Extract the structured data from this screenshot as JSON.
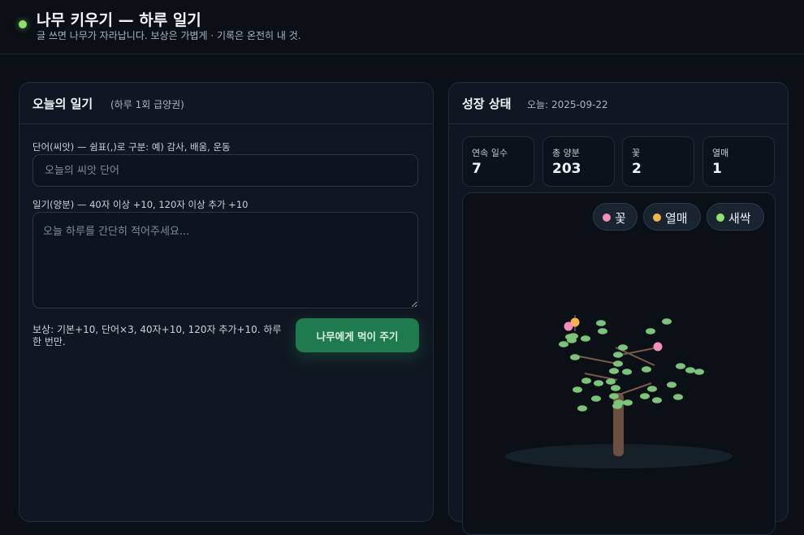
{
  "header": {
    "title": "나무 키우기 — 하루 일기",
    "subtitle": "글 쓰면 나무가 자라납니다. 보상은 가볍게 · 기록은 온전히 내 것.",
    "status_color": "#8fe36b"
  },
  "diary": {
    "title": "오늘의 일기",
    "note": "(하루 1회 급양권)",
    "seed_label": "단어(씨앗) — 쉼표(,)로 구분: 예) 감사, 배움, 운동",
    "seed_placeholder": "오늘의 씨앗 단어",
    "seed_value": "",
    "entry_label": "일기(양분) — 40자 이상 +10, 120자 이상 추가 +10",
    "entry_placeholder": "오늘 하루를 간단히 적어주세요...",
    "entry_value": "",
    "reward_text": "보상: 기본+10, 단어×3, 40자+10, 120자 추가+10. 하루 한 번만.",
    "feed_button": "나무에게 먹이 주기",
    "accent_color": "#1f7a4d"
  },
  "growth": {
    "title": "성장 상태",
    "date": "오늘: 2025-09-22",
    "stats": [
      {
        "label": "연속 일수",
        "value": "7"
      },
      {
        "label": "총 양분",
        "value": "203"
      },
      {
        "label": "꽃",
        "value": "2"
      },
      {
        "label": "열매",
        "value": "1"
      }
    ],
    "legend": [
      {
        "label": "꽃",
        "color": "#f58fba"
      },
      {
        "label": "열매",
        "color": "#f6b24d"
      },
      {
        "label": "새싹",
        "color": "#8fe36b"
      }
    ],
    "tree": {
      "trunk_color": "#6b5040",
      "branch_color": "#7a5a48",
      "leaf_color": "#7bc47a",
      "shadow_color": "#162028"
    }
  }
}
